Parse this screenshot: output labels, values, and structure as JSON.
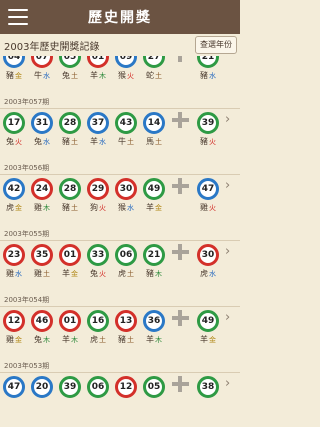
{
  "app_bar": {
    "title": "歷史開獎"
  },
  "sub_header": {
    "title": "2003年歷史開獎記錄",
    "year_button": "查選年份"
  },
  "draws": [
    {
      "issue": "",
      "balls": [
        {
          "n": "04",
          "c": "blue"
        },
        {
          "n": "07",
          "c": "red"
        },
        {
          "n": "05",
          "c": "green"
        },
        {
          "n": "01",
          "c": "red"
        },
        {
          "n": "09",
          "c": "blue"
        },
        {
          "n": "27",
          "c": "green"
        }
      ],
      "special": {
        "n": "21",
        "c": "green"
      },
      "zodiac": [
        {
          "a": "豬",
          "e": "金",
          "ec": "metal"
        },
        {
          "a": "牛",
          "e": "水",
          "ec": "water"
        },
        {
          "a": "兔",
          "e": "土",
          "ec": "earth"
        },
        {
          "a": "羊",
          "e": "木",
          "ec": "wood"
        },
        {
          "a": "猴",
          "e": "火",
          "ec": "fire"
        },
        {
          "a": "蛇",
          "e": "土",
          "ec": "earth"
        }
      ],
      "special_zodiac": {
        "a": "豬",
        "e": "水",
        "ec": "water"
      }
    },
    {
      "issue": "2003年057期",
      "balls": [
        {
          "n": "17",
          "c": "green"
        },
        {
          "n": "31",
          "c": "blue"
        },
        {
          "n": "28",
          "c": "green"
        },
        {
          "n": "37",
          "c": "blue"
        },
        {
          "n": "43",
          "c": "green"
        },
        {
          "n": "14",
          "c": "blue"
        }
      ],
      "special": {
        "n": "39",
        "c": "green"
      },
      "zodiac": [
        {
          "a": "兔",
          "e": "火",
          "ec": "fire"
        },
        {
          "a": "兔",
          "e": "水",
          "ec": "water"
        },
        {
          "a": "豬",
          "e": "土",
          "ec": "earth"
        },
        {
          "a": "羊",
          "e": "水",
          "ec": "water"
        },
        {
          "a": "牛",
          "e": "土",
          "ec": "earth"
        },
        {
          "a": "馬",
          "e": "土",
          "ec": "earth"
        }
      ],
      "special_zodiac": {
        "a": "豬",
        "e": "火",
        "ec": "fire"
      }
    },
    {
      "issue": "2003年056期",
      "balls": [
        {
          "n": "42",
          "c": "blue"
        },
        {
          "n": "24",
          "c": "red"
        },
        {
          "n": "28",
          "c": "green"
        },
        {
          "n": "29",
          "c": "red"
        },
        {
          "n": "30",
          "c": "red"
        },
        {
          "n": "49",
          "c": "green"
        }
      ],
      "special": {
        "n": "47",
        "c": "blue"
      },
      "zodiac": [
        {
          "a": "虎",
          "e": "金",
          "ec": "metal"
        },
        {
          "a": "雞",
          "e": "木",
          "ec": "wood"
        },
        {
          "a": "豬",
          "e": "土",
          "ec": "earth"
        },
        {
          "a": "狗",
          "e": "火",
          "ec": "fire"
        },
        {
          "a": "猴",
          "e": "水",
          "ec": "water"
        },
        {
          "a": "羊",
          "e": "金",
          "ec": "metal"
        }
      ],
      "special_zodiac": {
        "a": "雞",
        "e": "火",
        "ec": "fire"
      }
    },
    {
      "issue": "2003年055期",
      "balls": [
        {
          "n": "23",
          "c": "red"
        },
        {
          "n": "35",
          "c": "red"
        },
        {
          "n": "01",
          "c": "red"
        },
        {
          "n": "33",
          "c": "green"
        },
        {
          "n": "06",
          "c": "green"
        },
        {
          "n": "21",
          "c": "green"
        }
      ],
      "special": {
        "n": "30",
        "c": "red"
      },
      "zodiac": [
        {
          "a": "雞",
          "e": "水",
          "ec": "water"
        },
        {
          "a": "雞",
          "e": "土",
          "ec": "earth"
        },
        {
          "a": "羊",
          "e": "金",
          "ec": "metal"
        },
        {
          "a": "兔",
          "e": "火",
          "ec": "fire"
        },
        {
          "a": "虎",
          "e": "土",
          "ec": "earth"
        },
        {
          "a": "豬",
          "e": "木",
          "ec": "wood"
        }
      ],
      "special_zodiac": {
        "a": "虎",
        "e": "水",
        "ec": "water"
      }
    },
    {
      "issue": "2003年054期",
      "balls": [
        {
          "n": "12",
          "c": "red"
        },
        {
          "n": "46",
          "c": "red"
        },
        {
          "n": "01",
          "c": "red"
        },
        {
          "n": "16",
          "c": "green"
        },
        {
          "n": "13",
          "c": "red"
        },
        {
          "n": "36",
          "c": "blue"
        }
      ],
      "special": {
        "n": "49",
        "c": "green"
      },
      "zodiac": [
        {
          "a": "雞",
          "e": "金",
          "ec": "metal"
        },
        {
          "a": "兔",
          "e": "木",
          "ec": "wood"
        },
        {
          "a": "羊",
          "e": "木",
          "ec": "wood"
        },
        {
          "a": "虎",
          "e": "土",
          "ec": "earth"
        },
        {
          "a": "豬",
          "e": "土",
          "ec": "earth"
        },
        {
          "a": "羊",
          "e": "木",
          "ec": "wood"
        }
      ],
      "special_zodiac": {
        "a": "羊",
        "e": "金",
        "ec": "metal"
      }
    },
    {
      "issue": "2003年053期",
      "balls": [
        {
          "n": "47",
          "c": "blue"
        },
        {
          "n": "20",
          "c": "blue"
        },
        {
          "n": "39",
          "c": "green"
        },
        {
          "n": "06",
          "c": "green"
        },
        {
          "n": "12",
          "c": "red"
        },
        {
          "n": "05",
          "c": "green"
        }
      ],
      "special": {
        "n": "38",
        "c": "green"
      },
      "zodiac": [],
      "special_zodiac": null
    }
  ]
}
